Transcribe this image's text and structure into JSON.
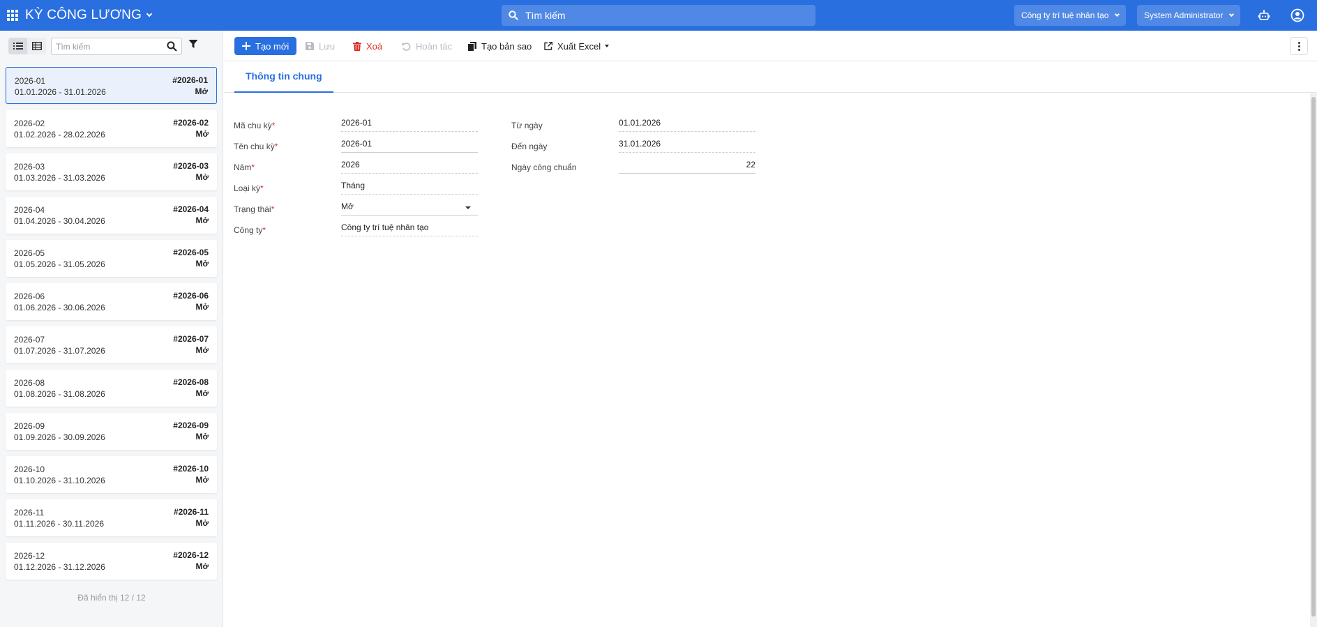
{
  "app": {
    "title": "KỲ CÔNG LƯƠNG"
  },
  "topbar": {
    "search_placeholder": "Tìm kiếm",
    "company": "Công ty trí tuệ nhân tạo",
    "user": "System Administrator",
    "accent": "#2a6fe0"
  },
  "list_panel": {
    "search_placeholder": "Tìm kiếm",
    "count_text": "Đã hiển thị 12 / 12",
    "records": [
      {
        "code": "2026-01",
        "range": "01.01.2026 - 31.01.2026",
        "number": "#2026-01",
        "status": "Mở",
        "active": true
      },
      {
        "code": "2026-02",
        "range": "01.02.2026 - 28.02.2026",
        "number": "#2026-02",
        "status": "Mở"
      },
      {
        "code": "2026-03",
        "range": "01.03.2026 - 31.03.2026",
        "number": "#2026-03",
        "status": "Mở"
      },
      {
        "code": "2026-04",
        "range": "01.04.2026 - 30.04.2026",
        "number": "#2026-04",
        "status": "Mở"
      },
      {
        "code": "2026-05",
        "range": "01.05.2026 - 31.05.2026",
        "number": "#2026-05",
        "status": "Mở"
      },
      {
        "code": "2026-06",
        "range": "01.06.2026 - 30.06.2026",
        "number": "#2026-06",
        "status": "Mở"
      },
      {
        "code": "2026-07",
        "range": "01.07.2026 - 31.07.2026",
        "number": "#2026-07",
        "status": "Mở"
      },
      {
        "code": "2026-08",
        "range": "01.08.2026 - 31.08.2026",
        "number": "#2026-08",
        "status": "Mở"
      },
      {
        "code": "2026-09",
        "range": "01.09.2026 - 30.09.2026",
        "number": "#2026-09",
        "status": "Mở"
      },
      {
        "code": "2026-10",
        "range": "01.10.2026 - 31.10.2026",
        "number": "#2026-10",
        "status": "Mở"
      },
      {
        "code": "2026-11",
        "range": "01.11.2026 - 30.11.2026",
        "number": "#2026-11",
        "status": "Mở"
      },
      {
        "code": "2026-12",
        "range": "01.12.2026 - 31.12.2026",
        "number": "#2026-12",
        "status": "Mở"
      }
    ]
  },
  "toolbar": {
    "create": "Tạo mới",
    "save": "Lưu",
    "delete": "Xoá",
    "undo": "Hoàn tác",
    "duplicate": "Tạo bản sao",
    "export": "Xuất Excel"
  },
  "tabs": {
    "general": "Thông tin chung"
  },
  "form": {
    "period_code_label": "Mã chu kỳ",
    "period_code": "2026-01",
    "period_name_label": "Tên chu kỳ",
    "period_name": "2026-01",
    "year_label": "Năm",
    "year": "2026",
    "period_type_label": "Loại kỳ",
    "period_type": "Tháng",
    "status_label": "Trạng thái",
    "status": "Mở",
    "company_label": "Công ty",
    "company": "Công ty trí tuệ nhân tạo",
    "from_date_label": "Từ ngày",
    "from_date": "01.01.2026",
    "to_date_label": "Đến ngày",
    "to_date": "31.01.2026",
    "standard_days_label": "Ngày công chuẩn",
    "standard_days": "22",
    "required_mark": "*"
  }
}
